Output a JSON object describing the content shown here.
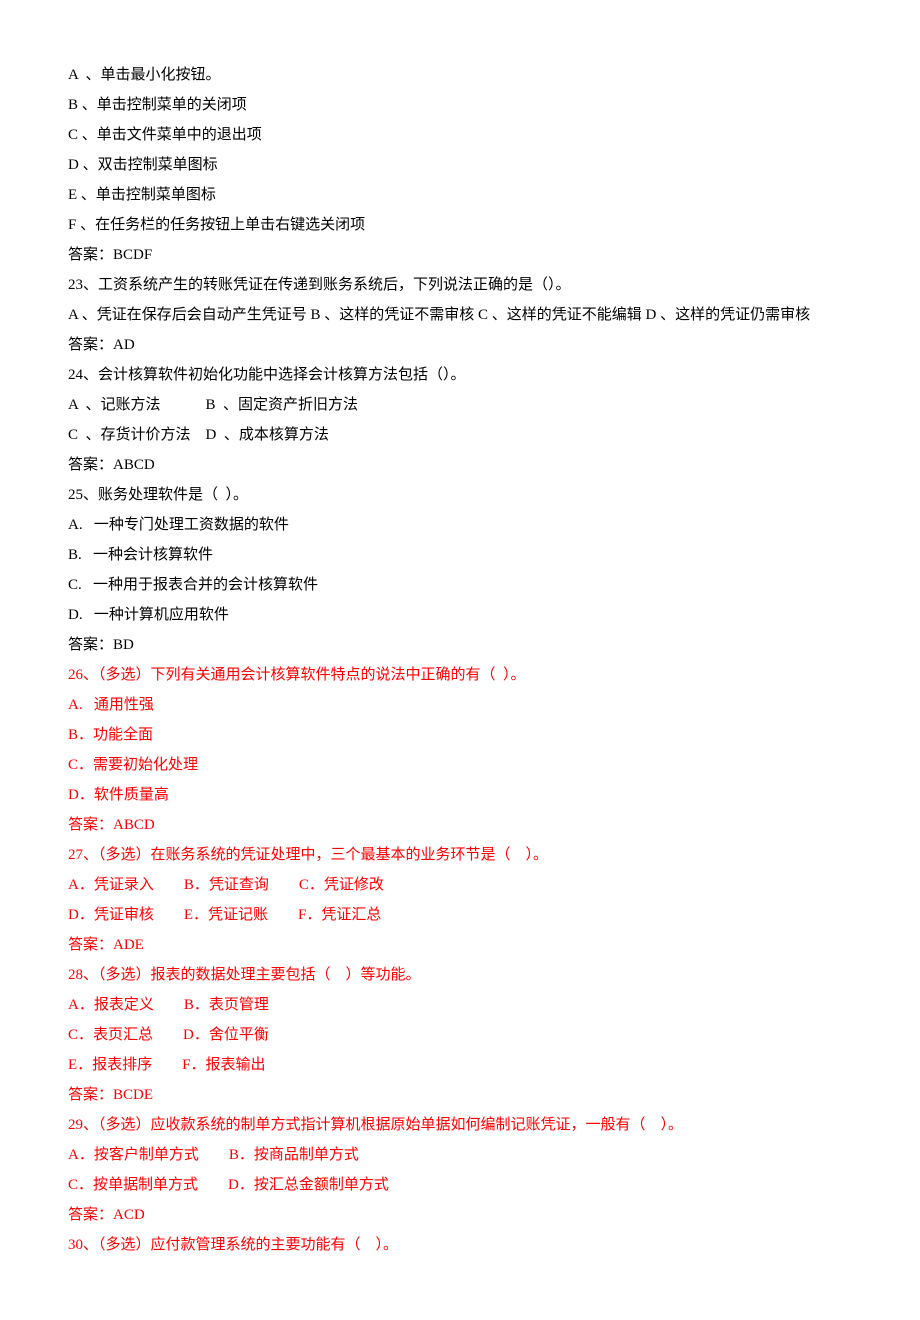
{
  "lines": [
    {
      "text": "A  、单击最小化按钮。",
      "red": false
    },
    {
      "text": "B 、单击控制菜单的关闭项",
      "red": false
    },
    {
      "text": "C 、单击文件菜单中的退出项",
      "red": false
    },
    {
      "text": "D 、双击控制菜单图标",
      "red": false
    },
    {
      "text": "E 、单击控制菜单图标",
      "red": false
    },
    {
      "text": "F 、在任务栏的任务按钮上单击右键选关闭项",
      "red": false
    },
    {
      "text": "答案：BCDF",
      "red": false
    },
    {
      "text": "23、工资系统产生的转账凭证在传递到账务系统后，下列说法正确的是（）。",
      "red": false
    },
    {
      "text": "A 、凭证在保存后会自动产生凭证号 B 、这样的凭证不需审核 C 、这样的凭证不能编辑 D 、这样的凭证仍需审核",
      "red": false
    },
    {
      "text": "答案：AD",
      "red": false
    },
    {
      "text": "24、会计核算软件初始化功能中选择会计核算方法包括（）。",
      "red": false
    },
    {
      "text": "A  、记账方法            B  、固定资产折旧方法",
      "red": false
    },
    {
      "text": "C  、存货计价方法    D  、成本核算方法",
      "red": false
    },
    {
      "text": "答案：ABCD",
      "red": false
    },
    {
      "text": "25、账务处理软件是（  ）。",
      "red": false
    },
    {
      "text": "A.   一种专门处理工资数据的软件",
      "red": false
    },
    {
      "text": "B.   一种会计核算软件",
      "red": false
    },
    {
      "text": "C.   一种用于报表合并的会计核算软件",
      "red": false
    },
    {
      "text": "D.   一种计算机应用软件",
      "red": false
    },
    {
      "text": "答案：BD",
      "red": false
    },
    {
      "text": "26、（多选）下列有关通用会计核算软件特点的说法中正确的有（  ）。",
      "red": true
    },
    {
      "text": "A.   通用性强",
      "red": true
    },
    {
      "text": "B．功能全面",
      "red": true
    },
    {
      "text": "C．需要初始化处理",
      "red": true
    },
    {
      "text": "D．软件质量高",
      "red": true
    },
    {
      "text": "答案：ABCD",
      "red": true
    },
    {
      "text": "27、（多选）在账务系统的凭证处理中，三个最基本的业务环节是（    ）。",
      "red": true
    },
    {
      "text": "A．凭证录入        B．凭证查询        C．凭证修改",
      "red": true
    },
    {
      "text": "D．凭证审核        E．凭证记账        F．凭证汇总",
      "red": true
    },
    {
      "text": "答案：ADE",
      "red": true
    },
    {
      "text": "28、（多选）报表的数据处理主要包括（    ）等功能。",
      "red": true
    },
    {
      "text": "A．报表定义        B．表页管理",
      "red": true
    },
    {
      "text": "C．表页汇总        D．舍位平衡",
      "red": true
    },
    {
      "text": "E．报表排序        F．报表输出",
      "red": true
    },
    {
      "text": "答案：BCDE",
      "red": true
    },
    {
      "text": "29、（多选）应收款系统的制单方式指计算机根据原始单据如何编制记账凭证，一般有（    ）。",
      "red": true
    },
    {
      "text": "A．按客户制单方式        B．按商品制单方式",
      "red": true
    },
    {
      "text": "C．按单据制单方式        D．按汇总金额制单方式",
      "red": true
    },
    {
      "text": "答案：ACD",
      "red": true
    },
    {
      "text": "30、（多选）应付款管理系统的主要功能有（    ）。",
      "red": true
    }
  ]
}
